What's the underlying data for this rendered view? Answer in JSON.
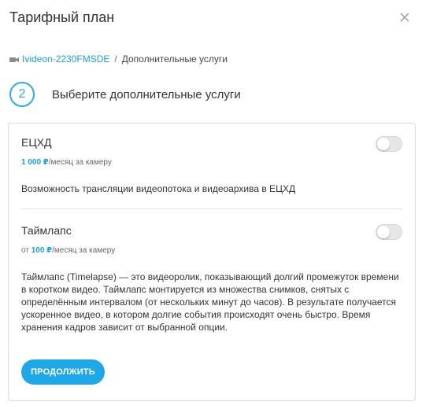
{
  "dialog": {
    "title": "Тарифный план"
  },
  "breadcrumb": {
    "camera": "Ivideon-2230FMSDE",
    "separator": "/",
    "current": "Дополнительные услуги"
  },
  "step": {
    "number": "2",
    "title": "Выберите дополнительные услуги"
  },
  "services": [
    {
      "name": "ЕЦХД",
      "price_prefix": "",
      "price_value": "1 000 ₽",
      "price_suffix": "/месяц за камеру",
      "description": "Возможность трансляции видеопотока и видеоархива в ЕЦХД",
      "enabled": false
    },
    {
      "name": "Таймлапс",
      "price_prefix": "от ",
      "price_value": "100 ₽",
      "price_suffix": "/месяц за камеру",
      "description": "Таймлапс (Timelapse) — это видеоролик, показывающий долгий промежуток времени в коротком видео. Таймлапс монтируется из множества снимков, снятых с определённым интервалом (от нескольких минут до часов). В результате получается ускоренное видео, в котором долгие события происходят очень быстро. Время хранения кадров зависит от выбранной опции.",
      "enabled": false
    }
  ],
  "actions": {
    "continue_label": "ПРОДОЛЖИТЬ"
  },
  "colors": {
    "accent": "#1ea8e7",
    "link": "#1b9fd8",
    "border": "#dadada"
  }
}
